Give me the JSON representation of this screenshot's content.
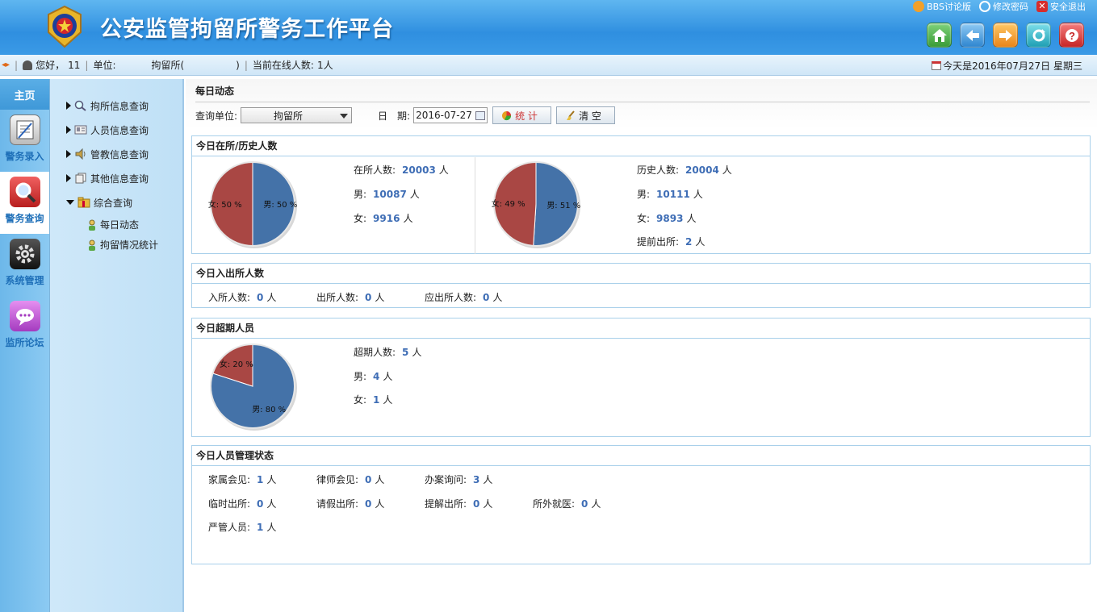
{
  "header": {
    "title": "公安监管拘留所警务工作平台",
    "top_links": [
      {
        "label": "BBS讨论版",
        "icon": "bbs-icon",
        "color": "#f1a02a"
      },
      {
        "label": "修改密码",
        "icon": "gear-icon",
        "color": "#ffffff"
      },
      {
        "label": "安全退出",
        "icon": "logout-icon",
        "color": "#d62d2d"
      }
    ],
    "nav_buttons": [
      {
        "name": "home-icon",
        "color": "#4bb34b"
      },
      {
        "name": "back-icon",
        "color": "#3f9be0"
      },
      {
        "name": "forward-icon",
        "color": "#f29a23"
      },
      {
        "name": "refresh-icon",
        "color": "#2fb1c5"
      },
      {
        "name": "help-icon",
        "color": "#d63a3a"
      }
    ]
  },
  "infobar": {
    "greeting": "您好，",
    "user": "11",
    "unit_label": "单位:",
    "unit_value": "拘留所(",
    "unit_close": ")",
    "online_label": "当前在线人数:",
    "online_count": "1人",
    "date_text": "今天是2016年07月27日 星期三"
  },
  "leftnav": {
    "home": "主页",
    "modules": [
      {
        "label": "警务录入",
        "icon": "notebook-icon",
        "active": false
      },
      {
        "label": "警务查询",
        "icon": "magnifier-icon",
        "active": true
      },
      {
        "label": "系统管理",
        "icon": "gear-icon",
        "active": false
      },
      {
        "label": "监所论坛",
        "icon": "chat-bubble-icon",
        "active": false
      }
    ]
  },
  "tree": {
    "items": [
      {
        "label": "拘所信息查询",
        "icon": "search-icon"
      },
      {
        "label": "人员信息查询",
        "icon": "id-card-icon"
      },
      {
        "label": "管教信息查询",
        "icon": "speaker-icon"
      },
      {
        "label": "其他信息查询",
        "icon": "documents-icon"
      },
      {
        "label": "综合查询",
        "icon": "folder-icon"
      }
    ],
    "sub_items": [
      {
        "label": "每日动态"
      },
      {
        "label": "拘留情况统计"
      }
    ]
  },
  "main": {
    "title": "每日动态",
    "query_unit_label": "查询单位:",
    "query_unit_value": "拘留所",
    "date_label": "日　期:",
    "date_value": "2016-07-27",
    "btn_stat": "统 计",
    "btn_clear": "清 空"
  },
  "panels": {
    "current_history": {
      "title": "今日在所/历史人数",
      "current": {
        "total_label": "在所人数:",
        "total": "20003",
        "male_label": "男:",
        "male": "10087",
        "female_label": "女:",
        "female": "9916",
        "unit": "人"
      },
      "history": {
        "total_label": "历史人数:",
        "total": "20004",
        "male_label": "男:",
        "male": "10111",
        "female_label": "女:",
        "female": "9893",
        "early_label": "提前出所:",
        "early": "2",
        "unit": "人"
      }
    },
    "inout": {
      "title": "今日入出所人数",
      "items": [
        {
          "label": "入所人数:",
          "value": "0",
          "unit": "人"
        },
        {
          "label": "出所人数:",
          "value": "0",
          "unit": "人"
        },
        {
          "label": "应出所人数:",
          "value": "0",
          "unit": "人"
        }
      ]
    },
    "overdue": {
      "title": "今日超期人员",
      "total_label": "超期人数:",
      "total": "5",
      "male_label": "男:",
      "male": "4",
      "female_label": "女:",
      "female": "1",
      "unit": "人"
    },
    "status": {
      "title": "今日人员管理状态",
      "items": [
        {
          "label": "家属会见:",
          "value": "1",
          "unit": "人"
        },
        {
          "label": "律师会见:",
          "value": "0",
          "unit": "人"
        },
        {
          "label": "办案询问:",
          "value": "3",
          "unit": "人"
        },
        {
          "label": "临时出所:",
          "value": "0",
          "unit": "人"
        },
        {
          "label": "请假出所:",
          "value": "0",
          "unit": "人"
        },
        {
          "label": "提解出所:",
          "value": "0",
          "unit": "人"
        },
        {
          "label": "所外就医:",
          "value": "0",
          "unit": "人"
        },
        {
          "label": "严管人员:",
          "value": "1",
          "unit": "人"
        }
      ]
    }
  },
  "chart_data": [
    {
      "type": "pie",
      "slices": [
        {
          "label": "男",
          "value": 50,
          "text": "男: 50 %",
          "color": "#4472a8"
        },
        {
          "label": "女",
          "value": 50,
          "text": "女: 50 %",
          "color": "#a94744"
        }
      ]
    },
    {
      "type": "pie",
      "slices": [
        {
          "label": "男",
          "value": 51,
          "text": "男: 51 %",
          "color": "#4472a8"
        },
        {
          "label": "女",
          "value": 49,
          "text": "女: 49 %",
          "color": "#a94744"
        }
      ]
    },
    {
      "type": "pie",
      "slices": [
        {
          "label": "男",
          "value": 80,
          "text": "男: 80 %",
          "color": "#4472a8"
        },
        {
          "label": "女",
          "value": 20,
          "text": "女: 20 %",
          "color": "#a94744"
        }
      ]
    }
  ]
}
